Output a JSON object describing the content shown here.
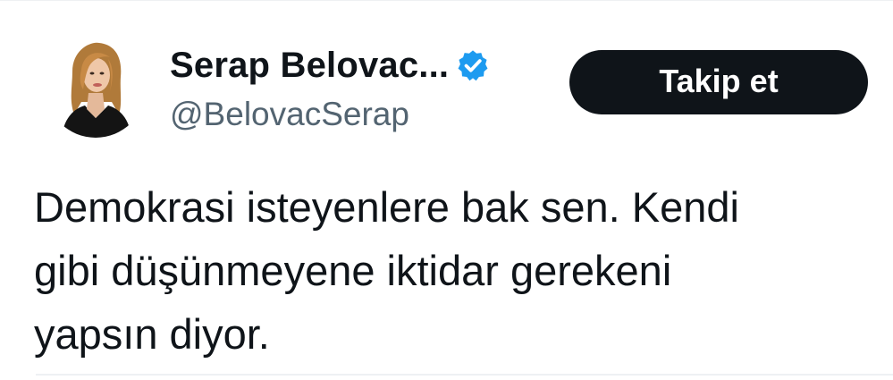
{
  "tweet": {
    "author": {
      "display_name": "Serap Belovac...",
      "handle": "@BelovacSerap",
      "verified": true,
      "avatar_icon": "profile-photo"
    },
    "follow_button_label": "Takip et",
    "text": "Demokrasi isteyenlere bak sen. Kendi\ngibi düşünmeyene iktidar gerekeni\nyapsın diyor."
  },
  "colors": {
    "text_primary": "#0f1419",
    "text_secondary": "#536471",
    "verified_badge": "#1d9bf0",
    "button_bg": "#0f1419",
    "button_text": "#ffffff"
  }
}
